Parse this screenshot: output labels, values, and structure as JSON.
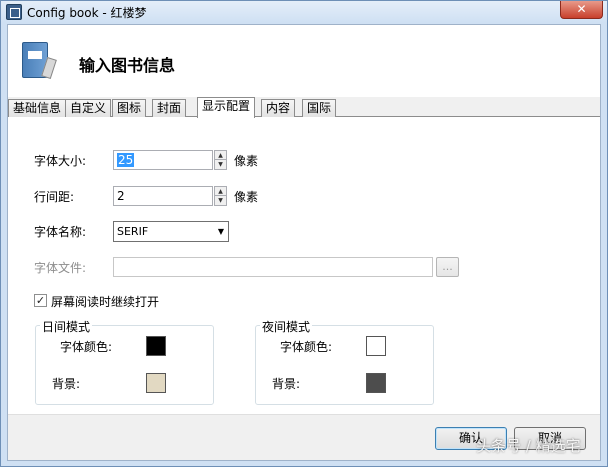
{
  "window": {
    "title": "Config book - 红楼梦",
    "close_glyph": "✕"
  },
  "header": {
    "title": "输入图书信息"
  },
  "tabs": [
    {
      "label": "基础信息",
      "active": false
    },
    {
      "label": "自定义",
      "active": false
    },
    {
      "label": "图标",
      "active": false
    },
    {
      "label": "封面",
      "active": false
    },
    {
      "label": "显示配置",
      "active": true
    },
    {
      "label": "内容",
      "active": false
    },
    {
      "label": "国际",
      "active": false
    }
  ],
  "display": {
    "font_size": {
      "label": "字体大小:",
      "value": "25",
      "unit": "像素"
    },
    "line_spacing": {
      "label": "行间距:",
      "value": "2",
      "unit": "像素"
    },
    "font_name": {
      "label": "字体名称:",
      "value": "SERIF"
    },
    "font_file": {
      "label": "字体文件:",
      "value": "",
      "browse_label": "..."
    },
    "continue_reading": {
      "label": "屏幕阅读时继续打开",
      "checked": true,
      "check_glyph": "✓"
    },
    "day_mode": {
      "title": "日间模式",
      "font_color_label": "字体颜色:",
      "font_color": "#000000",
      "background_label": "背景:",
      "background": "#e2d9c2"
    },
    "night_mode": {
      "title": "夜间模式",
      "font_color_label": "字体颜色:",
      "font_color": "#ffffff",
      "background_label": "背景:",
      "background": "#4d4d4d"
    }
  },
  "footer": {
    "ok_label": "确认",
    "cancel_label": "取消"
  },
  "watermark": "头条号 / 精选宅",
  "icons": {
    "app": "book-app-icon",
    "header": "book-edit-icon",
    "spin_up": "▲",
    "spin_down": "▼",
    "dropdown": "▼"
  },
  "colors": {
    "titlebar": "#cfe0f3",
    "selection": "#3399ff",
    "close": "#c8402c"
  }
}
